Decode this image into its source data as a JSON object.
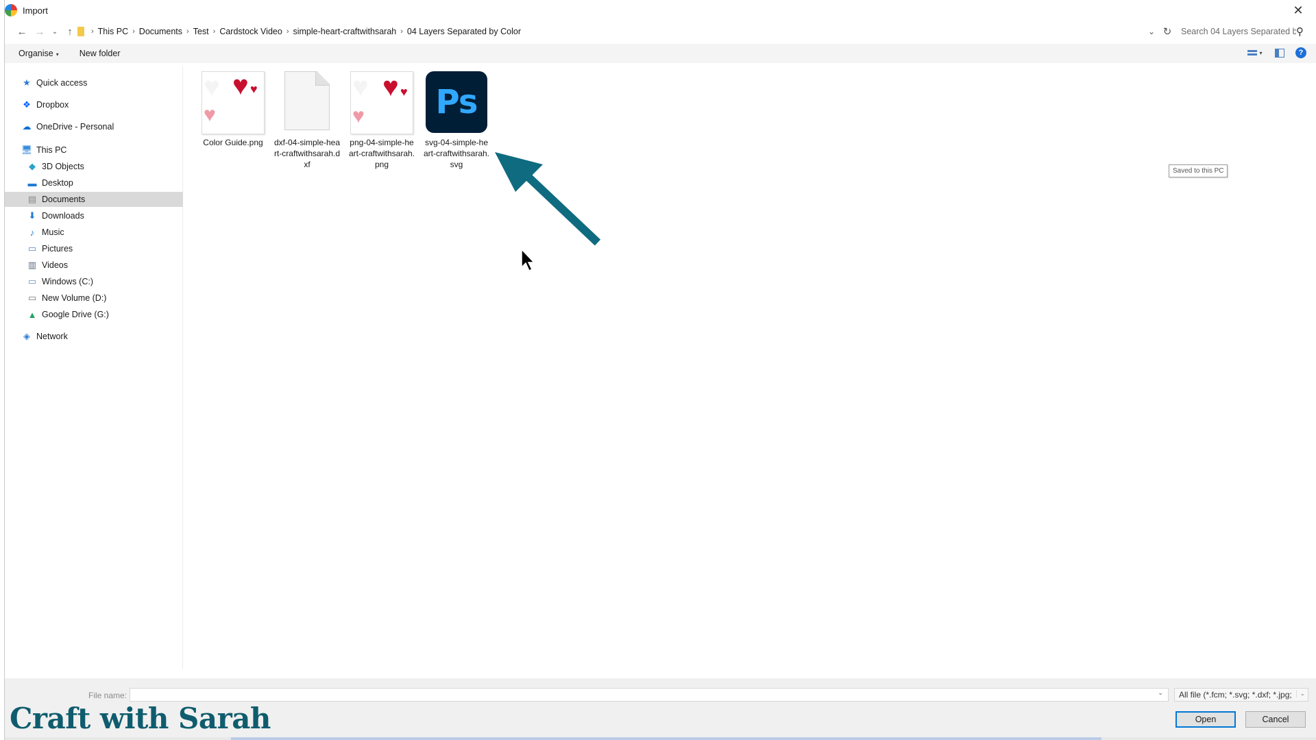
{
  "window": {
    "title": "Import"
  },
  "address": {
    "crumbs": [
      "This PC",
      "Documents",
      "Test",
      "Cardstock Video",
      "simple-heart-craftwithsarah",
      "04 Layers Separated by Color"
    ],
    "search_placeholder": "Search 04 Layers Separated by ..."
  },
  "toolbar": {
    "organise": "Organise",
    "new_folder": "New folder"
  },
  "nav": {
    "items": [
      {
        "label": "Quick access",
        "icon": "star-icon"
      },
      {
        "label": "Dropbox",
        "icon": "dropbox-icon"
      },
      {
        "label": "OneDrive - Personal",
        "icon": "cloud-icon"
      },
      {
        "label": "This PC",
        "icon": "computer-icon"
      },
      {
        "label": "3D Objects",
        "icon": "cube-icon"
      },
      {
        "label": "Desktop",
        "icon": "desktop-icon"
      },
      {
        "label": "Documents",
        "icon": "document-icon"
      },
      {
        "label": "Downloads",
        "icon": "download-icon"
      },
      {
        "label": "Music",
        "icon": "music-icon"
      },
      {
        "label": "Pictures",
        "icon": "pictures-icon"
      },
      {
        "label": "Videos",
        "icon": "video-icon"
      },
      {
        "label": "Windows (C:)",
        "icon": "drive-icon"
      },
      {
        "label": "New Volume (D:)",
        "icon": "drive-icon"
      },
      {
        "label": "Google Drive (G:)",
        "icon": "google-drive-icon"
      },
      {
        "label": "Network",
        "icon": "network-icon"
      }
    ],
    "selected": "Documents"
  },
  "files": [
    {
      "name": "Color Guide.png",
      "icon": "image-thumbnail"
    },
    {
      "name": "dxf-04-simple-heart-craftwithsarah.dxf",
      "icon": "generic-file-icon"
    },
    {
      "name": "png-04-simple-heart-craftwithsarah.png",
      "icon": "image-thumbnail"
    },
    {
      "name": "svg-04-simple-heart-craftwithsarah.svg",
      "icon": "photoshop-icon",
      "icon_text": "Ps"
    }
  ],
  "tooltip": "Saved to this PC",
  "bottom": {
    "file_name_label": "File name:",
    "file_name_value": "",
    "file_type": "All file (*.fcm; *.svg; *.dxf; *.jpg;",
    "open": "Open",
    "cancel": "Cancel"
  },
  "watermark": "Craft with Sarah",
  "colors": {
    "annotation_arrow": "#0f6b80",
    "selection": "#d9d9d9",
    "ps_bg": "#001e36",
    "ps_text": "#31a8ff",
    "heart_red": "#c8102e",
    "heart_pink": "#ef9aa6"
  }
}
